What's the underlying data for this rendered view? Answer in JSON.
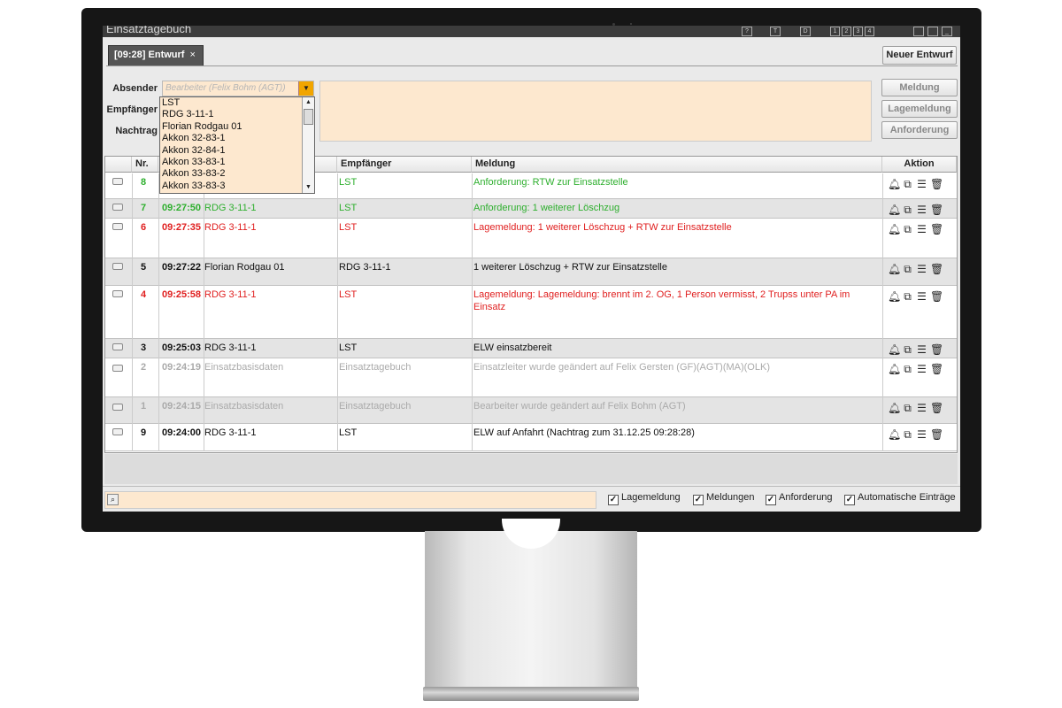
{
  "app": {
    "title": "Einsatztagebuch",
    "window_buttons": [
      "?",
      "T",
      "D",
      "1",
      "2",
      "3",
      "4",
      "",
      "",
      "_"
    ]
  },
  "tab": {
    "label": "[09:28] Entwurf",
    "close": "×"
  },
  "toolbar": {
    "new_draft": "Neuer Entwurf"
  },
  "form": {
    "absender_label": "Absender",
    "empfaenger_label": "Empfänger",
    "nachtrag_label": "Nachtrag",
    "absender_placeholder": "Bearbeiter (Felix Bohm (AGT))",
    "dropdown_options": [
      "LST",
      "RDG 3-11-1",
      "Florian Rodgau 01",
      "Akkon 32-83-1",
      "Akkon 32-84-1",
      "Akkon 33-83-1",
      "Akkon 33-83-2",
      "Akkon 33-83-3"
    ]
  },
  "side_buttons": {
    "meldung": "Meldung",
    "lagemeldung": "Lagemeldung",
    "anforderung": "Anforderung"
  },
  "table": {
    "headers": {
      "nr": "Nr.",
      "zeit": "",
      "absender": "",
      "empfaenger": "Empfänger",
      "meldung": "Meldung",
      "aktion": "Aktion"
    },
    "rows": [
      {
        "nr": "8",
        "time": "",
        "from": "",
        "to": "LST",
        "msg": "Anforderung: RTW zur Einsatzstelle",
        "color": "#2eaf2e"
      },
      {
        "nr": "7",
        "time": "09:27:50",
        "from": "RDG 3-11-1",
        "to": "LST",
        "msg": "Anforderung: 1 weiterer Löschzug",
        "color": "#2eaf2e"
      },
      {
        "nr": "6",
        "time": "09:27:35",
        "from": "RDG 3-11-1",
        "to": "LST",
        "msg": "Lagemeldung: 1 weiterer Löschzug + RTW zur Einsatzstelle",
        "color": "#e02020"
      },
      {
        "nr": "5",
        "time": "09:27:22",
        "from": "Florian Rodgau 01",
        "to": "RDG 3-11-1",
        "msg": "1 weiterer Löschzug + RTW zur Einsatzstelle",
        "color": "#111111"
      },
      {
        "nr": "4",
        "time": "09:25:58",
        "from": "RDG 3-11-1",
        "to": "LST",
        "msg": "Lagemeldung: Lagemeldung: brennt im 2. OG, 1 Person vermisst, 2 Trupss unter PA im Einsatz",
        "color": "#e02020"
      },
      {
        "nr": "3",
        "time": "09:25:03",
        "from": "RDG 3-11-1",
        "to": "LST",
        "msg": "ELW einsatzbereit",
        "color": "#111111"
      },
      {
        "nr": "2",
        "time": "09:24:19",
        "from": "Einsatzbasisdaten",
        "to": "Einsatztagebuch",
        "msg": "Einsatzleiter wurde geändert auf Felix Gersten (GF)(AGT)(MA)(OLK)",
        "color": "#aaaaaa"
      },
      {
        "nr": "1",
        "time": "09:24:15",
        "from": "Einsatzbasisdaten",
        "to": "Einsatztagebuch",
        "msg": "Bearbeiter wurde geändert auf Felix Bohm (AGT)",
        "color": "#aaaaaa"
      },
      {
        "nr": "9",
        "time": "09:24:00",
        "from": "RDG 3-11-1",
        "to": "LST",
        "msg": "ELW auf Anfahrt (Nachtrag zum 31.12.25 09:28:28)",
        "color": "#111111"
      }
    ],
    "action_icons": [
      "bell-icon",
      "copy-icon",
      "filter-icon",
      "delete-icon"
    ]
  },
  "filters": {
    "lagemeldung": "Lagemeldung",
    "meldungen": "Meldungen",
    "anforderung": "Anforderung",
    "automatische": "Automatische Einträge",
    "checked": "✓"
  }
}
